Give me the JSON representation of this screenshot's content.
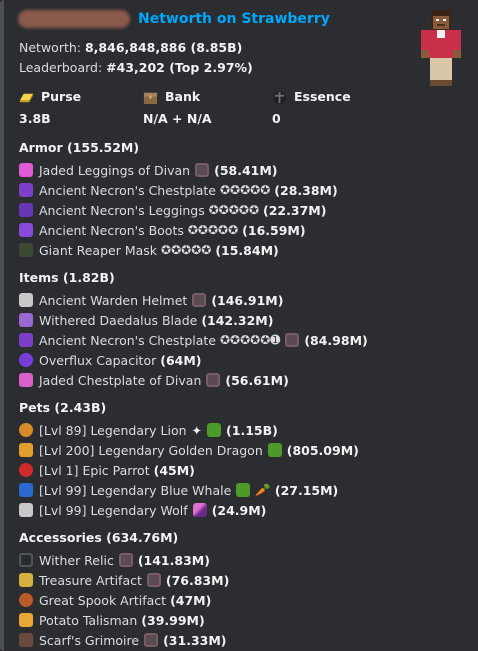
{
  "header": {
    "title": "Networth on Strawberry"
  },
  "summary": {
    "networth_label": "Networth:",
    "networth_value": "8,846,848,886 (8.85B)",
    "leaderboard_label": "Leaderboard:",
    "leaderboard_value": "#43,202 (Top 2.97%)"
  },
  "fields": {
    "purse_name": "Purse",
    "purse_value": "3.8B",
    "bank_name": "Bank",
    "bank_value": "N/A + N/A",
    "essence_name": "Essence",
    "essence_value": "0"
  },
  "sections": {
    "armor": {
      "title": "Armor (155.52M)",
      "items": [
        {
          "name": "Jaded Leggings of Divan",
          "stars": "",
          "extra": "enchant",
          "value": "(58.41M)",
          "icon": "pink-leggings-icon"
        },
        {
          "name": "Ancient Necron's Chestplate",
          "stars": "✪✪✪✪✪",
          "extra": "",
          "value": "(28.38M)",
          "icon": "purple-chestplate-icon"
        },
        {
          "name": "Ancient Necron's Leggings",
          "stars": "✪✪✪✪✪",
          "extra": "",
          "value": "(22.37M)",
          "icon": "purple-leggings-icon"
        },
        {
          "name": "Ancient Necron's Boots",
          "stars": "✪✪✪✪✪",
          "extra": "",
          "value": "(16.59M)",
          "icon": "purple-boots-icon"
        },
        {
          "name": "Giant Reaper Mask",
          "stars": "✪✪✪✪✪",
          "extra": "",
          "value": "(15.84M)",
          "icon": "reaper-mask-icon"
        }
      ]
    },
    "items": {
      "title": "Items (1.82B)",
      "items": [
        {
          "name": "Ancient Warden Helmet",
          "stars": "",
          "extra": "enchant",
          "value": "(146.91M)",
          "icon": "warden-helmet-icon"
        },
        {
          "name": "Withered Daedalus Blade",
          "stars": "",
          "extra": "",
          "value": "(142.32M)",
          "icon": "daedalus-blade-icon"
        },
        {
          "name": "Ancient Necron's Chestplate",
          "stars": "✪✪✪✪✪➊",
          "extra": "enchant",
          "value": "(84.98M)",
          "icon": "purple-chestplate-icon"
        },
        {
          "name": "Overflux Capacitor",
          "stars": "",
          "extra": "",
          "value": "(64M)",
          "icon": "overflux-capacitor-icon"
        },
        {
          "name": "Jaded Chestplate of Divan",
          "stars": "",
          "extra": "enchant",
          "value": "(56.61M)",
          "icon": "pink-chestplate-icon"
        }
      ]
    },
    "pets": {
      "title": "Pets (2.43B)",
      "items": [
        {
          "name": "[Lvl 89] Legendary Lion",
          "extra": "sparkle+green",
          "value": "(1.15B)",
          "icon": "lion-icon"
        },
        {
          "name": "[Lvl 200] Legendary Golden Dragon",
          "extra": "green",
          "value": "(805.09M)",
          "icon": "golden-dragon-icon"
        },
        {
          "name": "[Lvl 1] Epic Parrot",
          "extra": "",
          "value": "(45M)",
          "icon": "parrot-icon"
        },
        {
          "name": "[Lvl 99] Legendary Blue Whale",
          "extra": "green+carrot",
          "value": "(27.15M)",
          "icon": "blue-whale-icon"
        },
        {
          "name": "[Lvl 99] Legendary Wolf",
          "extra": "sword",
          "value": "(24.9M)",
          "icon": "wolf-icon"
        }
      ]
    },
    "accessories": {
      "title": "Accessories (634.76M)",
      "items": [
        {
          "name": "Wither Relic",
          "extra": "enchant",
          "value": "(141.83M)",
          "icon": "wither-relic-icon"
        },
        {
          "name": "Treasure Artifact",
          "extra": "enchant",
          "value": "(76.83M)",
          "icon": "treasure-artifact-icon"
        },
        {
          "name": "Great Spook Artifact",
          "extra": "",
          "value": "(47M)",
          "icon": "spook-artifact-icon"
        },
        {
          "name": "Potato Talisman",
          "extra": "",
          "value": "(39.99M)",
          "icon": "potato-talisman-icon"
        },
        {
          "name": "Scarf's Grimoire",
          "extra": "enchant",
          "value": "(31.33M)",
          "icon": "grimoire-icon"
        }
      ]
    }
  },
  "colors": {
    "background": "#2b2d31",
    "title_link": "#00a8fc",
    "text": "#dbdee1",
    "bold_text": "#f2f3f5"
  }
}
